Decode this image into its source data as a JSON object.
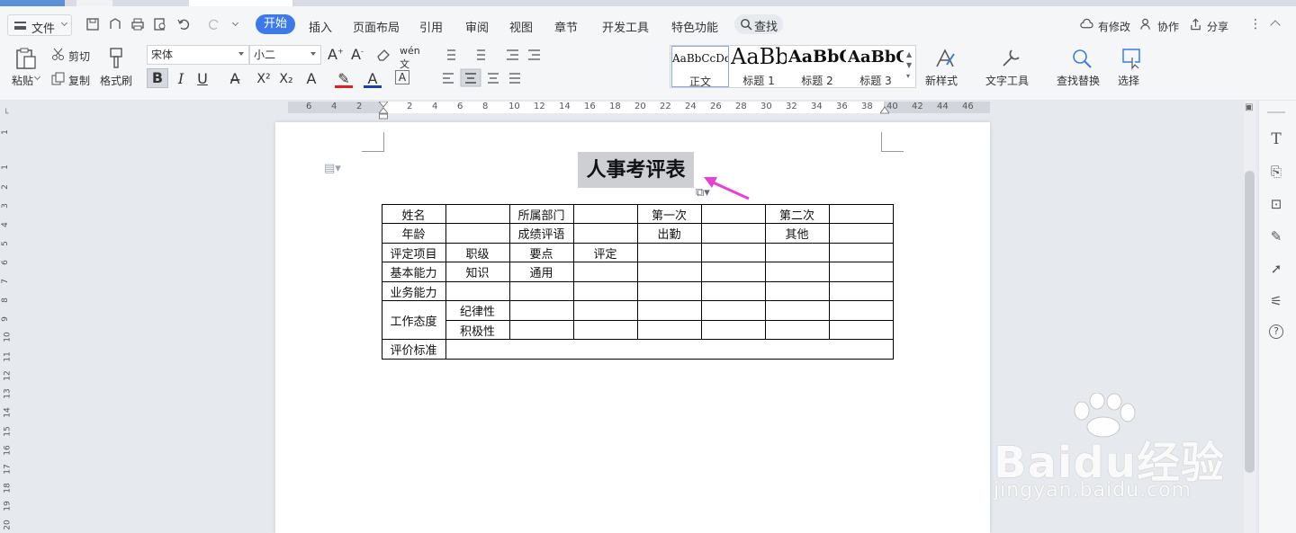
{
  "menubar": {
    "file": "文件",
    "tabs": [
      "开始",
      "插入",
      "页面布局",
      "引用",
      "审阅",
      "视图",
      "章节",
      "开发工具",
      "特色功能"
    ],
    "search": "查找",
    "right": {
      "modified": "有修改",
      "collaborate": "协作",
      "share": "分享"
    }
  },
  "toolbar": {
    "paste": "粘贴",
    "cut": "剪切",
    "copy": "复制",
    "format_painter": "格式刷",
    "font_name": "宋体",
    "font_size": "小二",
    "styles": [
      {
        "sample": "AaBbCcDd",
        "name": "正文"
      },
      {
        "sample": "AaBb",
        "name": "标题 1"
      },
      {
        "sample": "AaBbC",
        "name": "标题 2"
      },
      {
        "sample": "AaBbC",
        "name": "标题 3"
      }
    ],
    "new_style": "新样式",
    "text_tools": "文字工具",
    "find_replace": "查找替换",
    "select": "选择",
    "bold": "B",
    "italic": "I",
    "underline": "U"
  },
  "ruler": {
    "h_numbers": [
      "6",
      "4",
      "2",
      "2",
      "4",
      "6",
      "8",
      "10",
      "12",
      "14",
      "16",
      "18",
      "20",
      "22",
      "24",
      "26",
      "28",
      "30",
      "32",
      "34",
      "36",
      "38",
      "40",
      "42",
      "44",
      "46"
    ],
    "v_numbers": [
      "1",
      "1",
      "2",
      "3",
      "4",
      "5",
      "6",
      "7",
      "8",
      "9",
      "10",
      "11",
      "12",
      "13",
      "14",
      "15",
      "16",
      "17",
      "18",
      "19",
      "20"
    ]
  },
  "document": {
    "title": "人事考评表",
    "table": {
      "r1": [
        "姓名",
        "所属部门",
        "第一次",
        "第二次"
      ],
      "r2": [
        "年龄",
        "成绩评语",
        "出勤",
        "其他"
      ],
      "r3": [
        "评定项目",
        "职级",
        "要点",
        "评定"
      ],
      "r4": [
        "基本能力",
        "知识",
        "通用"
      ],
      "r5": [
        "业务能力"
      ],
      "r6": [
        "工作态度",
        "纪律性",
        "积极性"
      ],
      "r7": [
        "评价标准"
      ]
    }
  },
  "watermark": {
    "brand": "Baidu经验",
    "url": "jingyan.baidu.com"
  },
  "colors": {
    "accent": "#3b7ae8",
    "arrow": "#e83fd8",
    "title_highlight": "#cdcfd3"
  }
}
